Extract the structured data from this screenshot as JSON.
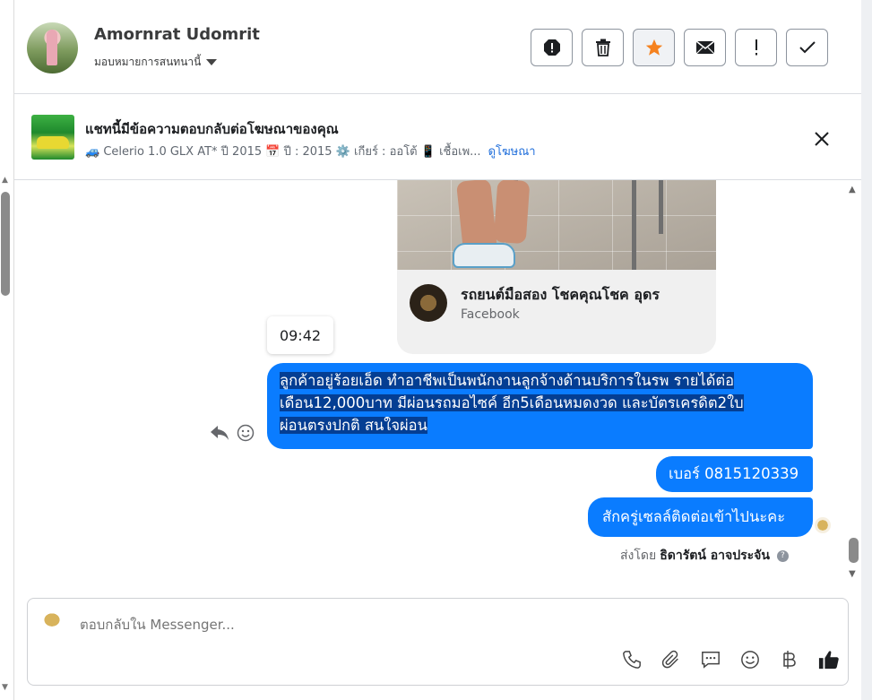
{
  "header": {
    "user_name": "Amornrat Udomrit",
    "assign_label": "มอบหมายการสนทนานี้",
    "actions": [
      "spam-icon",
      "trash-icon",
      "star-icon",
      "mail-icon",
      "exclamation-icon",
      "check-icon"
    ],
    "accent_star": "#f5821f"
  },
  "ad_banner": {
    "title": "แชทนี้มีข้อความตอบกลับต่อโฆษณาของคุณ",
    "description": "🚙 Celerio 1.0 GLX AT* ปี 2015 📅 ปี : 2015 ⚙️ เกียร์ : ออโต้ 📱 เชื้อเพ...",
    "view_ad_link": "ดูโฆษณา"
  },
  "chat": {
    "shared_post": {
      "page_name": "รถยนต์มือสอง โชคคุณโชค อุดร",
      "source": "Facebook"
    },
    "time_tooltip": "09:42",
    "messages": [
      {
        "line1": "ลูกค้าอยู่ร้อยเอ็ด ทำอาชีพเป็นพนักงานลูกจ้างด้านบริการในรพ รายได้ต่อ",
        "line2": "เดือน12,000บาท มีผ่อนรถมอไซค์ อีก5เดือนหมดงวด และบัตรเครดิต2ใบ",
        "line3": "ผ่อนตรงปกติ สนใจผ่อน"
      },
      {
        "text": "เบอร์ 0815120339"
      },
      {
        "text": "สักครู่เซลล์ติดต่อเข้าไปนะคะ"
      }
    ],
    "sent_by_prefix": "ส่งโดย",
    "sent_by_name": "ธิดารัตน์ อาจประจัน",
    "bubble_color": "#0a7cff"
  },
  "composer": {
    "placeholder": "ตอบกลับใน Messenger..."
  }
}
